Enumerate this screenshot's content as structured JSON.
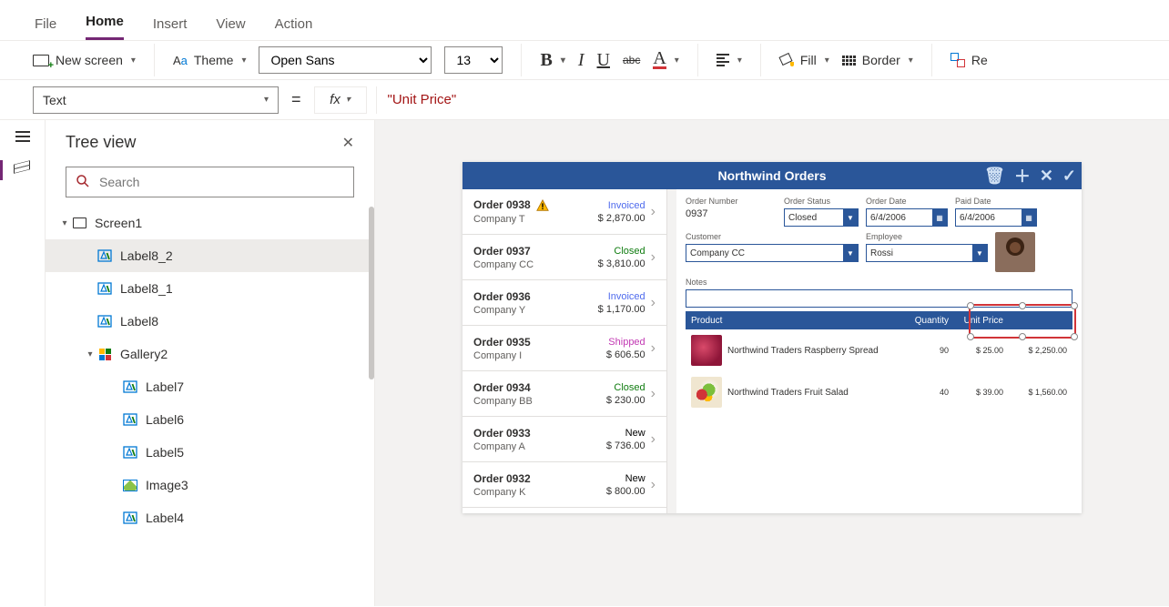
{
  "menu_tabs": {
    "file": "File",
    "home": "Home",
    "insert": "Insert",
    "view": "View",
    "action": "Action"
  },
  "ribbon": {
    "new_screen": "New screen",
    "theme_label": "Theme",
    "font_family": "Open Sans",
    "font_size": "13",
    "fill_label": "Fill",
    "border_label": "Border",
    "reorder_label_truncated": "Re"
  },
  "formula_bar": {
    "property": "Text",
    "fx_label": "fx",
    "value": "\"Unit Price\""
  },
  "tree": {
    "title": "Tree view",
    "search_placeholder": "Search",
    "items": {
      "screen1": "Screen1",
      "label8_2": "Label8_2",
      "label8_1": "Label8_1",
      "label8": "Label8",
      "gallery2": "Gallery2",
      "label7": "Label7",
      "label6": "Label6",
      "label5": "Label5",
      "image3": "Image3",
      "label4": "Label4"
    }
  },
  "app": {
    "title": "Northwind Orders",
    "list": [
      {
        "order": "Order 0938",
        "company": "Company T",
        "status": "Invoiced",
        "status_class": "st-invoiced",
        "amount": "$ 2,870.00",
        "warn": true
      },
      {
        "order": "Order 0937",
        "company": "Company CC",
        "status": "Closed",
        "status_class": "st-closed",
        "amount": "$ 3,810.00"
      },
      {
        "order": "Order 0936",
        "company": "Company Y",
        "status": "Invoiced",
        "status_class": "st-invoiced",
        "amount": "$ 1,170.00"
      },
      {
        "order": "Order 0935",
        "company": "Company I",
        "status": "Shipped",
        "status_class": "st-shipped",
        "amount": "$ 606.50"
      },
      {
        "order": "Order 0934",
        "company": "Company BB",
        "status": "Closed",
        "status_class": "st-closed",
        "amount": "$ 230.00"
      },
      {
        "order": "Order 0933",
        "company": "Company A",
        "status": "New",
        "status_class": "st-new",
        "amount": "$ 736.00"
      },
      {
        "order": "Order 0932",
        "company": "Company K",
        "status": "New",
        "status_class": "st-new",
        "amount": "$ 800.00"
      }
    ],
    "form": {
      "order_number_label": "Order Number",
      "order_number": "0937",
      "order_status_label": "Order Status",
      "order_status": "Closed",
      "order_date_label": "Order Date",
      "order_date": "6/4/2006",
      "paid_date_label": "Paid Date",
      "paid_date": "6/4/2006",
      "customer_label": "Customer",
      "customer": "Company CC",
      "employee_label": "Employee",
      "employee": "Rossi",
      "notes_label": "Notes"
    },
    "table_head": {
      "product": "Product",
      "qty": "Quantity",
      "unitprice": "Unit Price",
      "ext": ""
    },
    "lines": [
      {
        "name": "Northwind Traders Raspberry Spread",
        "qty": "90",
        "up": "$ 25.00",
        "ext": "$ 2,250.00",
        "img": "berry"
      },
      {
        "name": "Northwind Traders Fruit Salad",
        "qty": "40",
        "up": "$ 39.00",
        "ext": "$ 1,560.00",
        "img": "salad"
      }
    ]
  }
}
